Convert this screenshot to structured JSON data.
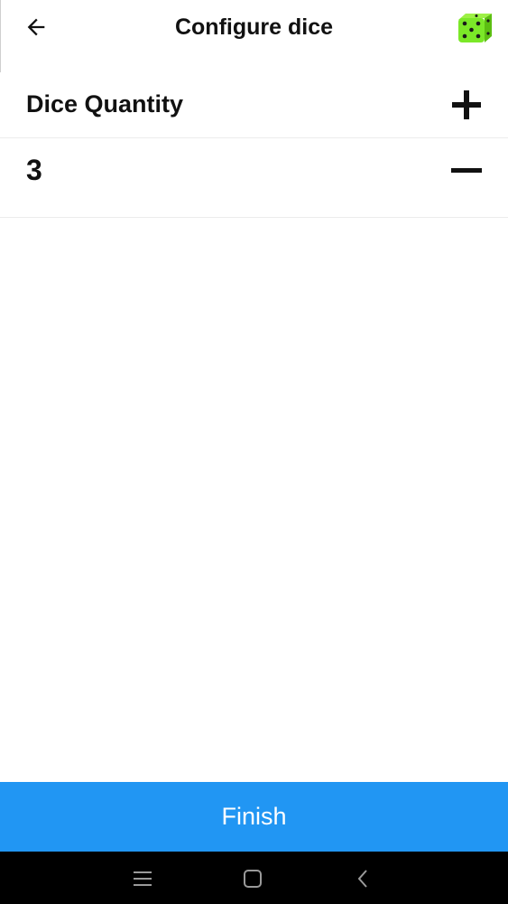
{
  "header": {
    "title": "Configure dice",
    "back_icon": "arrow-left-icon",
    "app_icon": "green-die-icon"
  },
  "dice": {
    "label": "Dice Quantity",
    "value": "3",
    "increase_icon": "plus-icon",
    "decrease_icon": "minus-icon"
  },
  "footer": {
    "finish_label": "Finish"
  },
  "navbar": {
    "icons": [
      "menu-icon",
      "home-icon",
      "back-icon"
    ]
  },
  "colors": {
    "accent": "#2196f3",
    "die_green": "#7be828",
    "navbar": "#000000",
    "text": "#111111"
  }
}
